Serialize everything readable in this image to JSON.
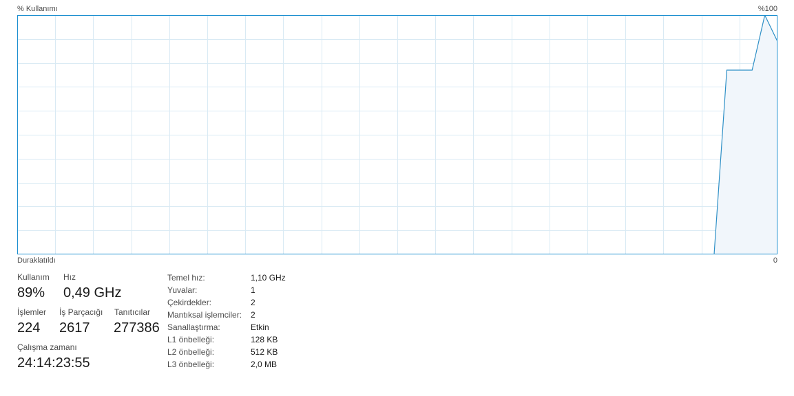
{
  "graph": {
    "title": "% Kullanımı",
    "max_label": "%100",
    "status_label": "Duraklatıldı",
    "min_label": "0",
    "colors": {
      "border": "#1d8fd0",
      "grid": "#d9eaf4",
      "line": "#2d8fc6",
      "fill": "#f1f6fb"
    },
    "usage_history_percent": [
      0,
      0,
      0,
      0,
      0,
      0,
      0,
      0,
      0,
      0,
      0,
      0,
      0,
      0,
      0,
      0,
      0,
      0,
      0,
      0,
      0,
      0,
      0,
      0,
      0,
      0,
      0,
      0,
      0,
      0,
      0,
      0,
      0,
      0,
      0,
      0,
      0,
      0,
      0,
      0,
      0,
      0,
      0,
      0,
      0,
      0,
      0,
      0,
      0,
      0,
      0,
      0,
      0,
      0,
      0,
      0,
      77,
      77,
      77,
      100,
      89
    ]
  },
  "stats": {
    "usage_label": "Kullanım",
    "usage_value": "89%",
    "speed_label": "Hız",
    "speed_value": "0,49 GHz",
    "processes_label": "İşlemler",
    "processes_value": "224",
    "threads_label": "İş Parçacığı",
    "threads_value": "2617",
    "handles_label": "Tanıtıcılar",
    "handles_value": "277386",
    "uptime_label": "Çalışma zamanı",
    "uptime_value": "24:14:23:55"
  },
  "specs": [
    {
      "label": "Temel hız:",
      "value": "1,10 GHz"
    },
    {
      "label": "Yuvalar:",
      "value": "1"
    },
    {
      "label": "Çekirdekler:",
      "value": "2"
    },
    {
      "label": "Mantıksal işlemciler:",
      "value": "2"
    },
    {
      "label": "Sanallaştırma:",
      "value": "Etkin"
    },
    {
      "label": "L1 önbelleği:",
      "value": "128 KB"
    },
    {
      "label": "L2 önbelleği:",
      "value": "512 KB"
    },
    {
      "label": "L3 önbelleği:",
      "value": "2,0 MB"
    }
  ]
}
